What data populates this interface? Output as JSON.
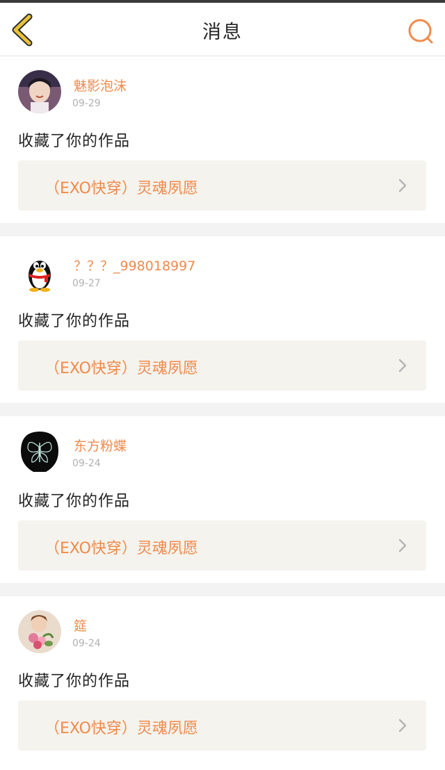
{
  "header": {
    "title": "消息"
  },
  "notifications": [
    {
      "name": "魅影泡沫",
      "date": "09-29",
      "action": "收藏了你的作品",
      "work_title": "（EXO快穿）灵魂夙愿",
      "avatar": "photo-boy-avatar"
    },
    {
      "name": "？？？_998018997",
      "date": "09-27",
      "action": "收藏了你的作品",
      "work_title": "（EXO快穿）灵魂夙愿",
      "avatar": "qq-penguin-avatar"
    },
    {
      "name": "东方粉蝶",
      "date": "09-24",
      "action": "收藏了你的作品",
      "work_title": "（EXO快穿）灵魂夙愿",
      "avatar": "butterfly-avatar"
    },
    {
      "name": "筵",
      "date": "09-24",
      "action": "收藏了你的作品",
      "work_title": "（EXO快穿）灵魂夙愿",
      "avatar": "flowers-photo-avatar"
    }
  ],
  "colors": {
    "accent": "#f08a4b",
    "back_icon": "#e8c23a",
    "link_bg": "#f4f3ee"
  }
}
